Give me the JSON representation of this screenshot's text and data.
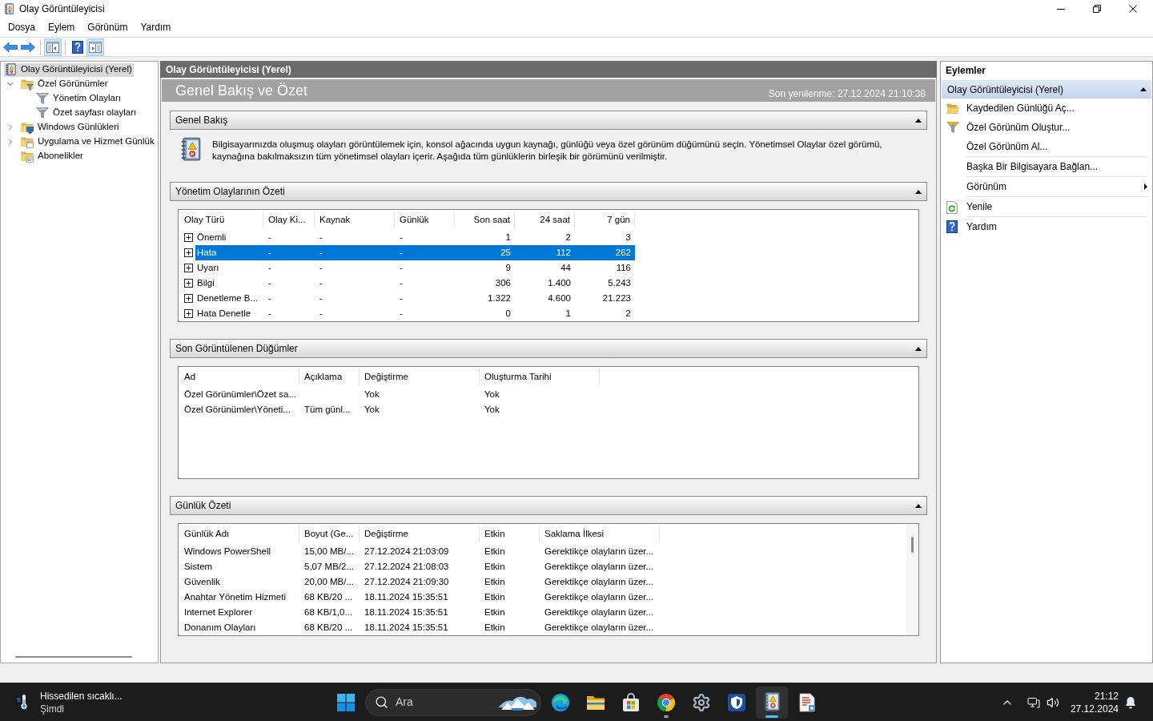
{
  "window": {
    "title": "Olay Görüntüleyicisi"
  },
  "menu_bar": {
    "items": [
      "Dosya",
      "Eylem",
      "Görünüm",
      "Yardım"
    ]
  },
  "toolbar": {
    "groups": [
      [
        {
          "kind": "back",
          "pressed": false
        },
        {
          "kind": "forward",
          "pressed": false
        }
      ],
      [
        {
          "kind": "console-tree",
          "pressed": true
        }
      ],
      [
        {
          "kind": "help",
          "pressed": false
        },
        {
          "kind": "action-pane",
          "pressed": true
        }
      ]
    ]
  },
  "tree": {
    "items": [
      {
        "label": "Olay Görüntüleyicisi (Yerel)",
        "kind": "root",
        "selected": true,
        "children": [
          {
            "label": "Özel Görünümler",
            "kind": "views-folder",
            "selected": false,
            "expanded": true,
            "children": [
              {
                "label": "Yönetim Olayları",
                "kind": "view",
                "selected": false
              },
              {
                "label": "Özet sayfası olayları",
                "kind": "view",
                "selected": false
              }
            ]
          },
          {
            "label": "Windows Günlükleri",
            "kind": "logs-folder",
            "selected": false,
            "expanded": false
          },
          {
            "label": "Uygulama ve Hizmet Günlük",
            "kind": "services-folder",
            "selected": false,
            "expanded": false
          },
          {
            "label": "Abonelikler",
            "kind": "subscriptions",
            "selected": false
          }
        ]
      }
    ]
  },
  "center": {
    "header": "Olay Görüntüleyicisi (Yerel)",
    "title": "Genel Bakış ve Özet",
    "refreshed": "Son yenilenme: 27.12.2024 21:10:38",
    "sections": [
      {
        "kind": "text",
        "title": "Genel Bakış",
        "expanded": true,
        "text": "Bilgisayarınızda oluşmuş olayları görüntülemek için, konsol ağacında uygun kaynağı, günlüğü veya özel görünüm düğümünü seçin. Yönetimsel Olaylar özel görümü, kaynağına bakılmaksızın tüm yönetimsel olayları içerir. Aşağıda tüm günlüklerin birleşik bir görümünü verilmiştir."
      },
      {
        "kind": "table",
        "title": "Yönetim Olaylarının Özeti",
        "expanded": true,
        "table": {
          "columns": [
            {
              "label": "Olay Türü",
              "kind": "text"
            },
            {
              "label": "Olay Ki...",
              "kind": "text"
            },
            {
              "label": "Kaynak",
              "kind": "text"
            },
            {
              "label": "Günlük",
              "kind": "text"
            },
            {
              "label": "Son saat",
              "kind": "count"
            },
            {
              "label": "24 saat",
              "kind": "count"
            },
            {
              "label": "7 gün",
              "kind": "count"
            }
          ],
          "rows": [
            {
              "expanded": false,
              "selected": false,
              "cells": [
                "Önemli",
                "-",
                "-",
                "-",
                "1",
                "2",
                "3"
              ]
            },
            {
              "expanded": false,
              "selected": true,
              "cells": [
                "Hata",
                "-",
                "-",
                "-",
                "25",
                "112",
                "262"
              ]
            },
            {
              "expanded": false,
              "selected": false,
              "cells": [
                "Uyarı",
                "-",
                "-",
                "-",
                "9",
                "44",
                "116"
              ]
            },
            {
              "expanded": false,
              "selected": false,
              "cells": [
                "Bilgi",
                "-",
                "-",
                "-",
                "306",
                "1.400",
                "5.243"
              ]
            },
            {
              "expanded": false,
              "selected": false,
              "cells": [
                "Denetleme B...",
                "-",
                "-",
                "-",
                "1.322",
                "4.600",
                "21.223"
              ]
            },
            {
              "expanded": false,
              "selected": false,
              "cells": [
                "Hata Denetle",
                "-",
                "-",
                "-",
                "0",
                "1",
                "2"
              ]
            }
          ]
        }
      },
      {
        "kind": "table",
        "title": "Son Görüntülenen Düğümler",
        "expanded": true,
        "table": {
          "columns": [
            {
              "label": "Ad",
              "kind": "text"
            },
            {
              "label": "Açıklama",
              "kind": "text"
            },
            {
              "label": "Değiştirme",
              "kind": "text"
            },
            {
              "label": "Oluşturma Tarihi",
              "kind": "text"
            }
          ],
          "rows": [
            {
              "selected": false,
              "cells": [
                "Özel Görünümler\\Özet sa...",
                null,
                "Yok",
                "Yok"
              ]
            },
            {
              "selected": false,
              "cells": [
                "Özel Görünümler\\Yöneti...",
                "Tüm günl...",
                "Yok",
                "Yok"
              ]
            }
          ]
        }
      },
      {
        "kind": "table",
        "title": "Günlük Özeti",
        "expanded": true,
        "table": {
          "scrollbar": true,
          "columns": [
            {
              "label": "Günlük Adı",
              "kind": "text"
            },
            {
              "label": "Boyut (Ge...",
              "kind": "text"
            },
            {
              "label": "Değiştirme",
              "kind": "text"
            },
            {
              "label": "Etkin",
              "kind": "text"
            },
            {
              "label": "Saklama İlkesi",
              "kind": "text"
            }
          ],
          "rows": [
            {
              "selected": false,
              "cells": [
                "Windows PowerShell",
                "15,00 MB/...",
                "27.12.2024 21:03:09",
                "Etkin",
                "Gerektikçe olayların üzer..."
              ]
            },
            {
              "selected": false,
              "cells": [
                "Sistem",
                "5,07 MB/2...",
                "27.12.2024 21:08:03",
                "Etkin",
                "Gerektikçe olayların üzer..."
              ]
            },
            {
              "selected": false,
              "cells": [
                "Güvenlik",
                "20,00 MB/...",
                "27.12.2024 21:09:30",
                "Etkin",
                "Gerektikçe olayların üzer..."
              ]
            },
            {
              "selected": false,
              "cells": [
                "Anahtar Yönetim Hizmeti",
                "68 KB/20 ...",
                "18.11.2024 15:35:51",
                "Etkin",
                "Gerektikçe olayların üzer..."
              ]
            },
            {
              "selected": false,
              "cells": [
                "Internet Explorer",
                "68 KB/1,0...",
                "18.11.2024 15:35:51",
                "Etkin",
                "Gerektikçe olayların üzer..."
              ]
            },
            {
              "selected": false,
              "cells": [
                "Donanım Olayları",
                "68 KB/20 ...",
                "18.11.2024 15:35:51",
                "Etkin",
                "Gerektikçe olayların üzer..."
              ]
            }
          ]
        }
      }
    ]
  },
  "actions": {
    "title": "Eylemler",
    "group": {
      "title": "Olay Görüntüleyicisi (Yerel)",
      "expanded": true,
      "items": [
        {
          "label": "Kaydedilen Günlüğü Aç...",
          "kind": "open-log",
          "divider": false
        },
        {
          "label": "Özel Görünüm Oluştur...",
          "kind": "create-view",
          "divider": false
        },
        {
          "label": "Özel Görünüm Al...",
          "kind": "plain",
          "divider": true
        },
        {
          "label": "Başka Bir Bilgisayara Bağlan...",
          "kind": "plain",
          "divider": true
        },
        {
          "label": "Görünüm",
          "kind": "submenu",
          "divider": true
        },
        {
          "label": "Yenile",
          "kind": "refresh",
          "divider": true
        },
        {
          "label": "Yardım",
          "kind": "help",
          "divider": false
        }
      ]
    }
  },
  "taskbar": {
    "weather": {
      "title": "Hissedilen sıcaklı...",
      "subtitle": "Şimdi"
    },
    "search": {
      "placeholder": "Ara"
    },
    "apps": [
      {
        "kind": "swirl",
        "running": false,
        "active": false
      },
      {
        "kind": "folder",
        "running": false,
        "active": false
      },
      {
        "kind": "bag",
        "running": false,
        "active": false
      },
      {
        "kind": "ball",
        "running": true,
        "active": false
      },
      {
        "kind": "gear",
        "running": false,
        "active": false
      },
      {
        "kind": "tile",
        "running": false,
        "active": false
      },
      {
        "kind": "event-log",
        "running": true,
        "active": true
      },
      {
        "kind": "document",
        "running": false,
        "active": false
      }
    ],
    "clock": {
      "time": "21:12",
      "date": "27.12.2024"
    }
  }
}
